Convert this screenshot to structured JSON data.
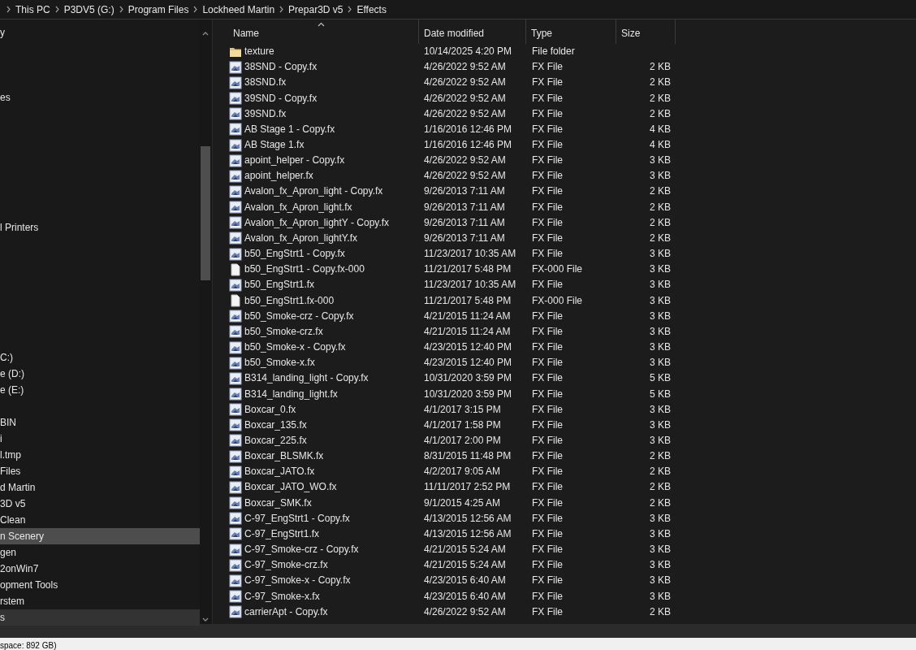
{
  "breadcrumb": [
    "This PC",
    "P3DV5 (G:)",
    "Program Files",
    "Lockheed Martin",
    "Prepar3D v5",
    "Effects"
  ],
  "sidebar": {
    "items": [
      {
        "label": "y",
        "selected": false,
        "hovered": false
      },
      {
        "label": "es",
        "selected": false,
        "hovered": false
      },
      {
        "label": "l Printers",
        "selected": false,
        "hovered": false
      },
      {
        "label": "C:)",
        "selected": false,
        "hovered": false
      },
      {
        "label": "e (D:)",
        "selected": false,
        "hovered": false
      },
      {
        "label": "e (E:)",
        "selected": false,
        "hovered": false
      },
      {
        "label": "BIN",
        "selected": false,
        "hovered": false
      },
      {
        "label": "i",
        "selected": false,
        "hovered": false
      },
      {
        "label": "l.tmp",
        "selected": false,
        "hovered": false
      },
      {
        "label": "Files",
        "selected": false,
        "hovered": false
      },
      {
        "label": "d Martin",
        "selected": false,
        "hovered": false
      },
      {
        "label": "3D v5",
        "selected": false,
        "hovered": false
      },
      {
        "label": "Clean",
        "selected": false,
        "hovered": false
      },
      {
        "label": "n Scenery",
        "selected": false,
        "hovered": true
      },
      {
        "label": "gen",
        "selected": false,
        "hovered": false
      },
      {
        "label": "2onWin7",
        "selected": false,
        "hovered": false
      },
      {
        "label": "opment Tools",
        "selected": false,
        "hovered": false
      },
      {
        "label": "rstem",
        "selected": false,
        "hovered": false
      },
      {
        "label": "s",
        "selected": true,
        "hovered": false
      }
    ]
  },
  "table": {
    "columns": [
      "Name",
      "Date modified",
      "Type",
      "Size"
    ],
    "rows": [
      {
        "kind": "folder",
        "name": "texture",
        "date": "10/14/2025 4:20 PM",
        "type": "File folder"
      },
      {
        "kind": "fx",
        "name": "38SND - Copy.fx",
        "date": "4/26/2022 9:52 AM",
        "type": "FX File",
        "size": "2 KB"
      },
      {
        "kind": "fx",
        "name": "38SND.fx",
        "date": "4/26/2022 9:52 AM",
        "type": "FX File",
        "size": "2 KB"
      },
      {
        "kind": "fx",
        "name": "39SND - Copy.fx",
        "date": "4/26/2022 9:52 AM",
        "type": "FX File",
        "size": "2 KB"
      },
      {
        "kind": "fx",
        "name": "39SND.fx",
        "date": "4/26/2022 9:52 AM",
        "type": "FX File",
        "size": "2 KB"
      },
      {
        "kind": "fx",
        "name": "AB Stage 1 - Copy.fx",
        "date": "1/16/2016 12:46 PM",
        "type": "FX File",
        "size": "4 KB"
      },
      {
        "kind": "fx",
        "name": "AB Stage 1.fx",
        "date": "1/16/2016 12:46 PM",
        "type": "FX File",
        "size": "4 KB"
      },
      {
        "kind": "fx",
        "name": "apoint_helper - Copy.fx",
        "date": "4/26/2022 9:52 AM",
        "type": "FX File",
        "size": "3 KB"
      },
      {
        "kind": "fx",
        "name": "apoint_helper.fx",
        "date": "4/26/2022 9:52 AM",
        "type": "FX File",
        "size": "3 KB"
      },
      {
        "kind": "fx",
        "name": "Avalon_fx_Apron_light - Copy.fx",
        "date": "9/26/2013 7:11 AM",
        "type": "FX File",
        "size": "2 KB"
      },
      {
        "kind": "fx",
        "name": "Avalon_fx_Apron_light.fx",
        "date": "9/26/2013 7:11 AM",
        "type": "FX File",
        "size": "2 KB"
      },
      {
        "kind": "fx",
        "name": "Avalon_fx_Apron_lightY - Copy.fx",
        "date": "9/26/2013 7:11 AM",
        "type": "FX File",
        "size": "2 KB"
      },
      {
        "kind": "fx",
        "name": "Avalon_fx_Apron_lightY.fx",
        "date": "9/26/2013 7:11 AM",
        "type": "FX File",
        "size": "2 KB"
      },
      {
        "kind": "fx",
        "name": "b50_EngStrt1 - Copy.fx",
        "date": "11/23/2017 10:35 AM",
        "type": "FX File",
        "size": "3 KB"
      },
      {
        "kind": "blank",
        "name": "b50_EngStrt1 - Copy.fx-000",
        "date": "11/21/2017 5:48 PM",
        "type": "FX-000 File",
        "size": "3 KB"
      },
      {
        "kind": "fx",
        "name": "b50_EngStrt1.fx",
        "date": "11/23/2017 10:35 AM",
        "type": "FX File",
        "size": "3 KB"
      },
      {
        "kind": "blank",
        "name": "b50_EngStrt1.fx-000",
        "date": "11/21/2017 5:48 PM",
        "type": "FX-000 File",
        "size": "3 KB"
      },
      {
        "kind": "fx",
        "name": "b50_Smoke-crz - Copy.fx",
        "date": "4/21/2015 11:24 AM",
        "type": "FX File",
        "size": "3 KB"
      },
      {
        "kind": "fx",
        "name": "b50_Smoke-crz.fx",
        "date": "4/21/2015 11:24 AM",
        "type": "FX File",
        "size": "3 KB"
      },
      {
        "kind": "fx",
        "name": "b50_Smoke-x - Copy.fx",
        "date": "4/23/2015 12:40 PM",
        "type": "FX File",
        "size": "3 KB"
      },
      {
        "kind": "fx",
        "name": "b50_Smoke-x.fx",
        "date": "4/23/2015 12:40 PM",
        "type": "FX File",
        "size": "3 KB"
      },
      {
        "kind": "fx",
        "name": "B314_landing_light - Copy.fx",
        "date": "10/31/2020 3:59 PM",
        "type": "FX File",
        "size": "5 KB"
      },
      {
        "kind": "fx",
        "name": "B314_landing_light.fx",
        "date": "10/31/2020 3:59 PM",
        "type": "FX File",
        "size": "5 KB"
      },
      {
        "kind": "fx",
        "name": "Boxcar_0.fx",
        "date": "4/1/2017 3:15 PM",
        "type": "FX File",
        "size": "3 KB"
      },
      {
        "kind": "fx",
        "name": "Boxcar_135.fx",
        "date": "4/1/2017 1:58 PM",
        "type": "FX File",
        "size": "3 KB"
      },
      {
        "kind": "fx",
        "name": "Boxcar_225.fx",
        "date": "4/1/2017 2:00 PM",
        "type": "FX File",
        "size": "3 KB"
      },
      {
        "kind": "fx",
        "name": "Boxcar_BLSMK.fx",
        "date": "8/31/2015 11:48 PM",
        "type": "FX File",
        "size": "2 KB"
      },
      {
        "kind": "fx",
        "name": "Boxcar_JATO.fx",
        "date": "4/2/2017 9:05 AM",
        "type": "FX File",
        "size": "2 KB"
      },
      {
        "kind": "fx",
        "name": "Boxcar_JATO_WO.fx",
        "date": "11/11/2017 2:52 PM",
        "type": "FX File",
        "size": "2 KB"
      },
      {
        "kind": "fx",
        "name": "Boxcar_SMK.fx",
        "date": "9/1/2015 4:25 AM",
        "type": "FX File",
        "size": "2 KB"
      },
      {
        "kind": "fx",
        "name": "C-97_EngStrt1 - Copy.fx",
        "date": "4/13/2015 12:56 AM",
        "type": "FX File",
        "size": "3 KB"
      },
      {
        "kind": "fx",
        "name": "C-97_EngStrt1.fx",
        "date": "4/13/2015 12:56 AM",
        "type": "FX File",
        "size": "3 KB"
      },
      {
        "kind": "fx",
        "name": "C-97_Smoke-crz - Copy.fx",
        "date": "4/21/2015 5:24 AM",
        "type": "FX File",
        "size": "3 KB"
      },
      {
        "kind": "fx",
        "name": "C-97_Smoke-crz.fx",
        "date": "4/21/2015 5:24 AM",
        "type": "FX File",
        "size": "3 KB"
      },
      {
        "kind": "fx",
        "name": "C-97_Smoke-x - Copy.fx",
        "date": "4/23/2015 6:40 AM",
        "type": "FX File",
        "size": "3 KB"
      },
      {
        "kind": "fx",
        "name": "C-97_Smoke-x.fx",
        "date": "4/23/2015 6:40 AM",
        "type": "FX File",
        "size": "3 KB"
      },
      {
        "kind": "fx",
        "name": "carrierApt - Copy.fx",
        "date": "4/26/2022 9:52 AM",
        "type": "FX File",
        "size": "2 KB"
      }
    ]
  },
  "status_bar": "space: 892 GB)"
}
